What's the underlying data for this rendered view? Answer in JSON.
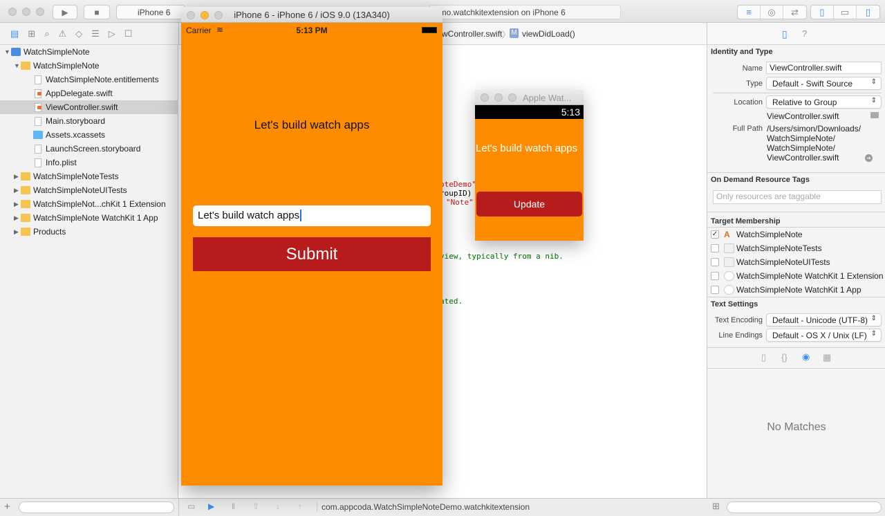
{
  "toolbar": {
    "scheme": "iPhone 6",
    "activity": "emo.watchkitextension on iPhone 6",
    "icons": [
      "play-icon",
      "stop-icon",
      "standard-editor-icon",
      "assistant-editor-icon",
      "version-editor-icon",
      "navigator-toggle-icon",
      "debug-toggle-icon",
      "utilities-toggle-icon"
    ]
  },
  "navigator": {
    "tabs": [
      "folder-icon",
      "hierarchy-icon",
      "search-icon",
      "warning-icon",
      "test-icon",
      "debug-icon",
      "breakpoint-icon",
      "report-icon"
    ],
    "items": [
      {
        "label": "WatchSimpleNote",
        "type": "project",
        "depth": 0,
        "disclosure": "open"
      },
      {
        "label": "WatchSimpleNote",
        "type": "folder",
        "depth": 1,
        "disclosure": "open"
      },
      {
        "label": "WatchSimpleNote.entitlements",
        "type": "file",
        "depth": 2
      },
      {
        "label": "AppDelegate.swift",
        "type": "swift",
        "depth": 2
      },
      {
        "label": "ViewController.swift",
        "type": "swift",
        "depth": 2,
        "selected": true
      },
      {
        "label": "Main.storyboard",
        "type": "file",
        "depth": 2
      },
      {
        "label": "Assets.xcassets",
        "type": "assets",
        "depth": 2
      },
      {
        "label": "LaunchScreen.storyboard",
        "type": "file",
        "depth": 2
      },
      {
        "label": "Info.plist",
        "type": "file",
        "depth": 2
      },
      {
        "label": "WatchSimpleNoteTests",
        "type": "folder",
        "depth": 1,
        "disclosure": "closed"
      },
      {
        "label": "WatchSimpleNoteUITests",
        "type": "folder",
        "depth": 1,
        "disclosure": "closed"
      },
      {
        "label": "WatchSimpleNot...chKit 1 Extension",
        "type": "folder",
        "depth": 1,
        "disclosure": "closed"
      },
      {
        "label": "WatchSimpleNote WatchKit 1 App",
        "type": "folder",
        "depth": 1,
        "disclosure": "closed"
      },
      {
        "label": "Products",
        "type": "folder",
        "depth": 1,
        "disclosure": "closed"
      }
    ]
  },
  "editor": {
    "breadcrumb_file": "wController.swift",
    "breadcrumb_method": "viewDidLoad()",
    "method_badge": "M",
    "code_fragments": [
      "oteDemo\"",
      "roupID)",
      "\"Note\"",
      "view, typically from a nib.",
      "ated."
    ]
  },
  "iphone_sim": {
    "title": "iPhone 6 - iPhone 6 / iOS 9.0 (13A340)",
    "carrier": "Carrier",
    "time": "5:13 PM",
    "label": "Let's build watch apps",
    "input_value": "Let's build watch apps",
    "submit_label": "Submit",
    "bg_color": "#ff8c00",
    "button_color": "#b71c1c"
  },
  "watch_sim": {
    "title": "Apple Wat...",
    "time": "5:13",
    "label": "Let's build watch apps",
    "button_label": "Update"
  },
  "inspector": {
    "identity_title": "Identity and Type",
    "name_label": "Name",
    "name_value": "ViewController.swift",
    "type_label": "Type",
    "type_value": "Default - Swift Source",
    "location_label": "Location",
    "location_value": "Relative to Group",
    "location_file": "ViewController.swift",
    "fullpath_label": "Full Path",
    "fullpath_lines": [
      "/Users/simon/Downloads/",
      "WatchSimpleNote/",
      "WatchSimpleNote/",
      "ViewController.swift"
    ],
    "odr_title": "On Demand Resource Tags",
    "odr_placeholder": "Only resources are taggable",
    "target_title": "Target Membership",
    "targets": [
      {
        "label": "WatchSimpleNote",
        "checked": true
      },
      {
        "label": "WatchSimpleNoteTests",
        "checked": false
      },
      {
        "label": "WatchSimpleNoteUITests",
        "checked": false
      },
      {
        "label": "WatchSimpleNote WatchKit 1 Extension",
        "checked": false
      },
      {
        "label": "WatchSimpleNote WatchKit 1 App",
        "checked": false
      }
    ],
    "text_title": "Text Settings",
    "encoding_label": "Text Encoding",
    "encoding_value": "Default - Unicode (UTF-8)",
    "endings_label": "Line Endings",
    "endings_value": "Default - OS X / Unix (LF)",
    "library_empty": "No Matches"
  },
  "debug": {
    "target": "com.appcoda.WatchSimpleNoteDemo.watchkitextension"
  }
}
